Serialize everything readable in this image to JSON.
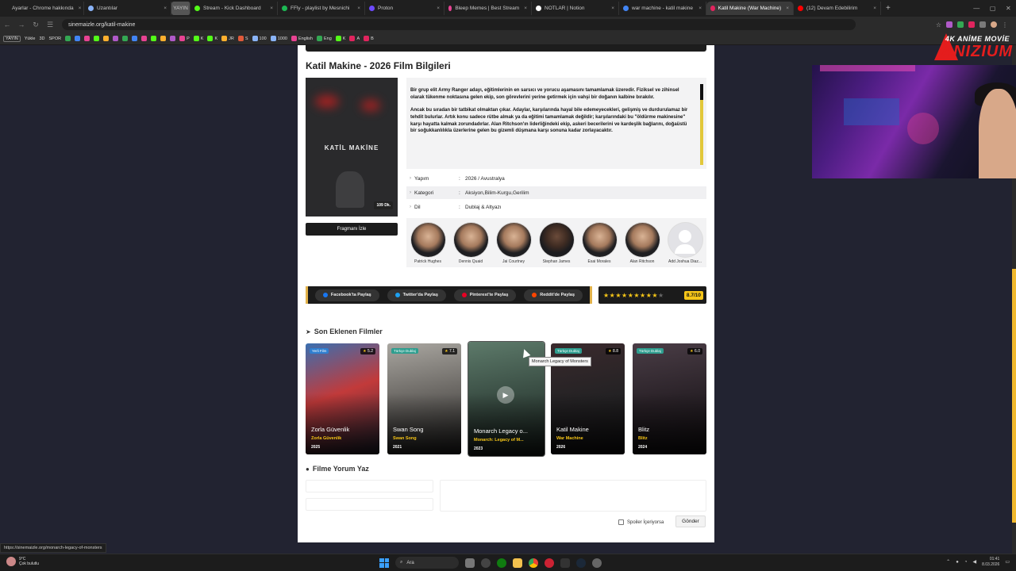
{
  "browser": {
    "tabs": [
      {
        "label": "Ayarlar - Chrome hakkında",
        "color": "#8ab4f8"
      },
      {
        "label": "Uzantılar",
        "color": "#8ab4f8"
      },
      {
        "label": "YAYIN",
        "color": "#5f6368",
        "badge": true
      },
      {
        "label": "Stream - Kick Dashboard",
        "color": "#53fc18"
      },
      {
        "label": "FFly - playlist by Mesnichi",
        "color": "#1db954"
      },
      {
        "label": "Proton",
        "color": "#6d4aff"
      },
      {
        "label": "Bleep Memes | Best Stream",
        "color": "#e84393"
      },
      {
        "label": "NOTLAR | Notion",
        "color": "#ffffff"
      },
      {
        "label": "war machine - katil makine",
        "color": "#4285f4"
      },
      {
        "label": "Katil Makine (War Machine)",
        "color": "#e0245e",
        "active": true
      },
      {
        "label": "(12) Devam Edebilirim",
        "color": "#ff0000"
      }
    ],
    "newtab": "+",
    "url": "sinemaizle.org/katil-makine",
    "bookmarks": [
      {
        "label": "YAYIN",
        "boxed": true
      },
      {
        "label": "Yükle"
      },
      {
        "label": "3D"
      },
      {
        "label": "SPOR"
      },
      {
        "label": "P",
        "color": "#e84393"
      },
      {
        "label": "K",
        "color": "#53fc18"
      },
      {
        "label": "K",
        "color": "#53fc18"
      },
      {
        "label": "JR",
        "color": "#ffb02e"
      },
      {
        "label": "S",
        "color": "#e05a3a"
      },
      {
        "label": "100",
        "color": "#8ab4f8"
      },
      {
        "label": "1000",
        "color": "#8ab4f8"
      },
      {
        "label": "English",
        "color": "#e84393"
      },
      {
        "label": "Eng",
        "color": "#34a853"
      },
      {
        "label": "K",
        "color": "#53fc18"
      },
      {
        "label": "A",
        "color": "#e0245e"
      },
      {
        "label": "B",
        "color": "#e0245e"
      }
    ]
  },
  "film": {
    "title": "Katil Makine - 2026 Film Bilgileri",
    "poster_title": "KATİL MAKİNE",
    "duration": "109 Dk.",
    "trailer_button": "Fragmanı İzle",
    "synopsis_p1": "Bir grup elit Army Ranger adayı, eğitimlerinin en sarsıcı ve yorucu aşamasını tamamlamak üzeredir. Fiziksel ve zihinsel olarak tükenme noktasına gelen ekip, son görevlerini yerine getirmek için vahşi bir doğanın kalbine bırakılır.",
    "synopsis_p2": "Ancak bu sıradan bir tatbikat olmaktan çıkar. Adaylar, karşılarında hayal bile edemeyecekleri, gelişmiş ve durdurulamaz bir tehdit bulurlar. Artık konu sadece rütbe almak ya da eğitimi tamamlamak değildir; karşılarındaki bu \"öldürme makinesine\" karşı hayatta kalmak zorundadırlar. Alan Ritchson'ın liderliğindeki ekip, askeri becerilerini ve kardeşlik bağlarını, doğaüstü bir soğukkanlılıkla üzerlerine gelen bu gizemli düşmana karşı sonuna kadar zorlayacaktır.",
    "info": [
      {
        "label": "Yapım",
        "sep": ":",
        "value": "2026 / Avustralya"
      },
      {
        "label": "Kategori",
        "sep": ":",
        "value": "Aksiyon,Bilim-Kurgu,Gerilim"
      },
      {
        "label": "Dil",
        "sep": ":",
        "value": "Dublaj & Altyazı"
      }
    ],
    "cast": [
      {
        "name": "Patrick Hughes"
      },
      {
        "name": "Dennis Quaid"
      },
      {
        "name": "Jai Courtney"
      },
      {
        "name": "Stephan James"
      },
      {
        "name": "Esai Morales"
      },
      {
        "name": "Alan Ritchson"
      },
      {
        "name": "Add Joshua Diaz..."
      }
    ],
    "share": [
      {
        "label": "Facebook'ta Paylaş",
        "color": "#1877f2"
      },
      {
        "label": "Twitter'da Paylaş",
        "color": "#1da1f2"
      },
      {
        "label": "Pinterest'te Paylaş",
        "color": "#e60023"
      },
      {
        "label": "Reddit'de Paylaş",
        "color": "#ff4500"
      }
    ],
    "rating": {
      "stars_filled": "★★★★★★★★★",
      "stars_empty": "★",
      "score": "8.7/10",
      "value": 8.7,
      "max": 10
    }
  },
  "recent": {
    "title": "Son Eklenen Filmler",
    "movies": [
      {
        "name": "Zorla Güvenlik",
        "orig": "Zorla Güvenlik",
        "year": "2025",
        "badge": "Yerli Film",
        "rating": "5.2",
        "bg": "linear-gradient(160deg,#3a6fb0 0%,#c23a3a 45%,#2a2a3a 100%)"
      },
      {
        "name": "Swan Song",
        "orig": "Swan Song",
        "year": "2021",
        "badge": "Türkçe Dublaj",
        "rating": "7.1",
        "bg": "linear-gradient(170deg,#a9a6a0 0%,#6d6a66 45%,#2d2c2b 100%)"
      },
      {
        "name": "Monarch Legacy o...",
        "orig": "Monarch: Legacy of M...",
        "year": "2023",
        "badge": "",
        "rating": "",
        "bg": "linear-gradient(170deg,#5d7a6a 0%,#3b4f45 45%,#1b2420 100%)"
      },
      {
        "name": "Katil Makine",
        "orig": "War Machine",
        "year": "2026",
        "badge": "Türkçe Dublaj",
        "rating": "8.8",
        "bg": "linear-gradient(170deg,#3a2a2d 0%,#242224 50%,#131214 100%)"
      },
      {
        "name": "Blitz",
        "orig": "Blitz",
        "year": "2024",
        "badge": "Türkçe Dublaj",
        "rating": "6.0",
        "bg": "linear-gradient(170deg,#4a3d46 0%,#2a2228 50%,#151215 100%)"
      }
    ],
    "tooltip": "Monarch Legacy of Monsters"
  },
  "comment": {
    "title": "Filme Yorum Yaz",
    "spoiler_label": "Spoiler İçeriyorsa",
    "send_button": "Gönder"
  },
  "status_url": "https://sinemaizle.org/monarch-legacy-of-monsters",
  "overlay": {
    "logo_line1": "4K ANİME MOVİE",
    "logo_line2": "ANIZIUM"
  },
  "taskbar": {
    "weather_temp": "9°C",
    "weather_desc": "Çok bulutlu",
    "search": "Ara",
    "time": "01:41",
    "date": "8.03.2026"
  }
}
